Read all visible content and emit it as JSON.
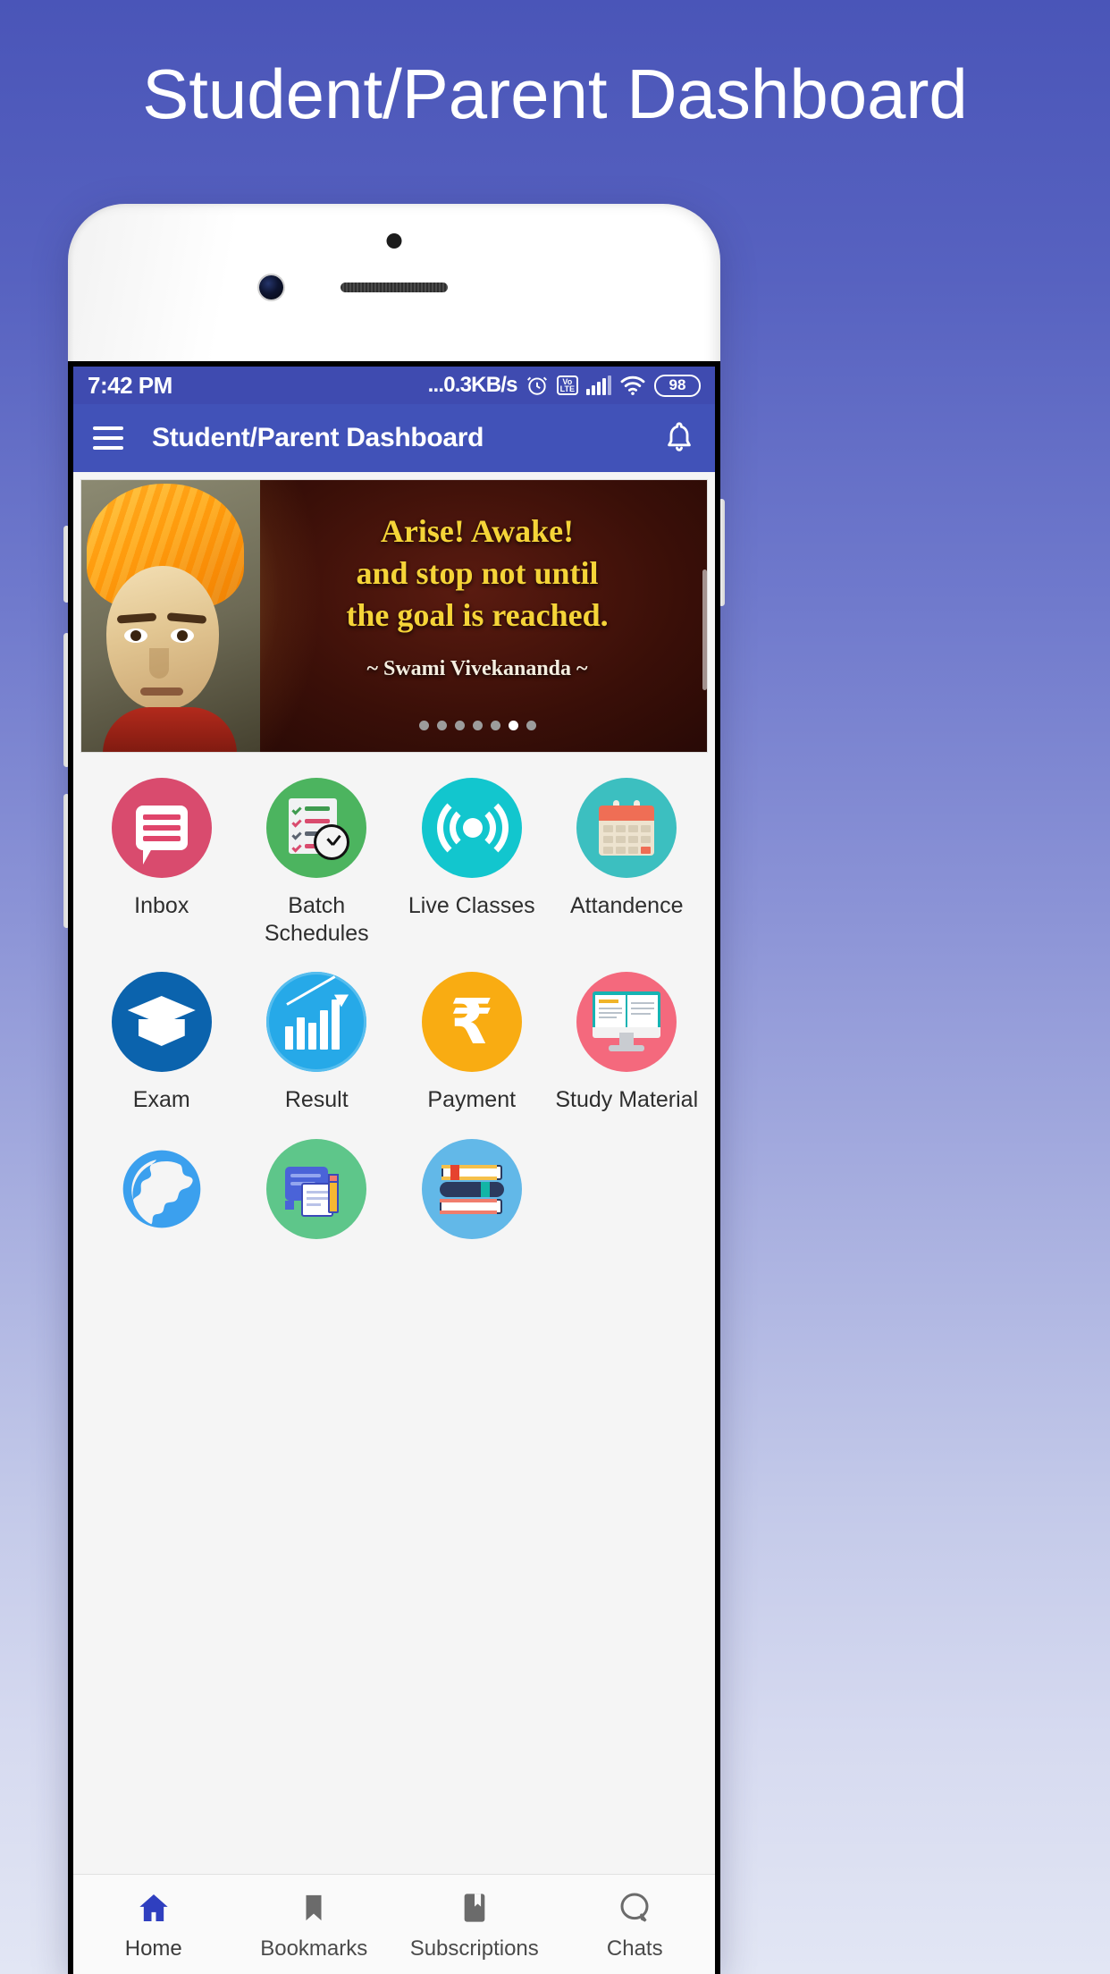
{
  "promo": {
    "title": "Student/Parent Dashboard"
  },
  "colors": {
    "status_bar": "#3f4bb0",
    "app_bar": "#4152b8",
    "page_bg_top": "#4a55b8",
    "page_bg_bottom": "#e2e6f4",
    "nav_active": "#2f3fbf"
  },
  "status_bar": {
    "time": "7:42 PM",
    "network_speed": "...0.3KB/s",
    "alarm_icon": "alarm-clock-icon",
    "volte_top": "Vo",
    "volte_bottom": "LTE",
    "signal_icon": "signal-bars-icon",
    "wifi_icon": "wifi-icon",
    "battery_level": "98"
  },
  "app_bar": {
    "menu_icon": "hamburger-menu-icon",
    "title": "Student/Parent Dashboard",
    "notification_icon": "bell-icon"
  },
  "banner": {
    "quote_line1": "Arise! Awake!",
    "quote_line2": "and stop not until",
    "quote_line3": "the goal is reached.",
    "author": "~ Swami Vivekananda ~",
    "portrait_alt": "swami-vivekananda-portrait",
    "dot_count": 7,
    "active_dot": 6
  },
  "grid": {
    "tiles": [
      {
        "label": "Inbox",
        "icon": "inbox-chat-icon",
        "color": "#d94b6e"
      },
      {
        "label": "Batch\nSchedules",
        "icon": "batch-schedule-icon",
        "color": "#4cb45f"
      },
      {
        "label": "Live Classes",
        "icon": "live-broadcast-icon",
        "color": "#12c6ce"
      },
      {
        "label": "Attandence",
        "icon": "calendar-icon",
        "color": "#3cbfc0"
      },
      {
        "label": "Exam",
        "icon": "graduation-cap-icon",
        "color": "#0b63ad"
      },
      {
        "label": "Result",
        "icon": "growth-chart-icon",
        "color": "#26a9e8"
      },
      {
        "label": "Payment",
        "icon": "rupee-icon",
        "color": "#f9ac12"
      },
      {
        "label": "Study Material",
        "icon": "monitor-book-icon",
        "color": "#f4697d"
      },
      {
        "label": "",
        "icon": "globe-icon",
        "color": "#ffffff"
      },
      {
        "label": "",
        "icon": "notes-pencil-icon",
        "color": "#5ec68a"
      },
      {
        "label": "",
        "icon": "books-stack-icon",
        "color": "#62b8e8"
      }
    ]
  },
  "bottom_nav": {
    "items": [
      {
        "label": "Home",
        "icon": "home-icon",
        "active": true
      },
      {
        "label": "Bookmarks",
        "icon": "bookmark-icon",
        "active": false
      },
      {
        "label": "Subscriptions",
        "icon": "subscription-icon",
        "active": false
      },
      {
        "label": "Chats",
        "icon": "chat-bubble-icon",
        "active": false
      }
    ]
  }
}
